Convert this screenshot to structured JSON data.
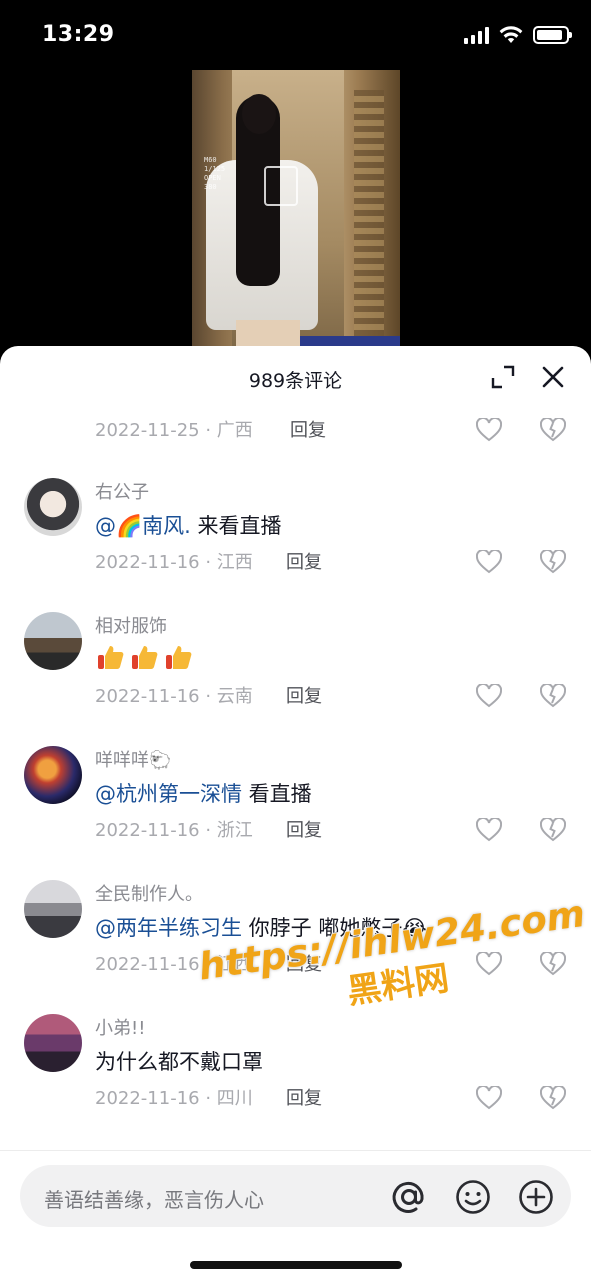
{
  "status_bar": {
    "time": "13:29",
    "battery_level": 0.9
  },
  "sheet": {
    "title": "989条评论"
  },
  "colors": {
    "mention": "#1a4f95",
    "watermark": "#f0a417"
  },
  "comments_partial_top": {
    "date_location": "2022-11-25 · 广西",
    "reply_label": "回复"
  },
  "comments": [
    {
      "nickname": "右公子",
      "mention": "@🌈南风.",
      "text": " 来看直播",
      "date_location": "2022-11-16 · 江西",
      "reply_label": "回复"
    },
    {
      "nickname": "相对服饰",
      "emoji": "thumbs-up x3",
      "date_location": "2022-11-16 · 云南",
      "reply_label": "回复"
    },
    {
      "nickname": "咩咩咩🐑",
      "mention": "@杭州第一深情",
      "text": " 看直播",
      "date_location": "2022-11-16 · 浙江",
      "reply_label": "回复"
    },
    {
      "nickname": "全民制作人。",
      "mention": "@两年半练习生",
      "text": " 你脖子 嘟她憋子😭",
      "date_location": "2022-11-16 · 江西",
      "reply_label": "回复"
    },
    {
      "nickname": "小弟!!",
      "text": "为什么都不戴口罩",
      "date_location": "2022-11-16 · 四川",
      "reply_label": "回复"
    }
  ],
  "input": {
    "placeholder": "善语结善缘，恶言伤人心"
  },
  "video_overlay": [
    "M60",
    "1/125",
    "OPEN",
    "380"
  ],
  "watermark": {
    "line1": "https://ihlw24.com",
    "line2": "黑料网"
  }
}
